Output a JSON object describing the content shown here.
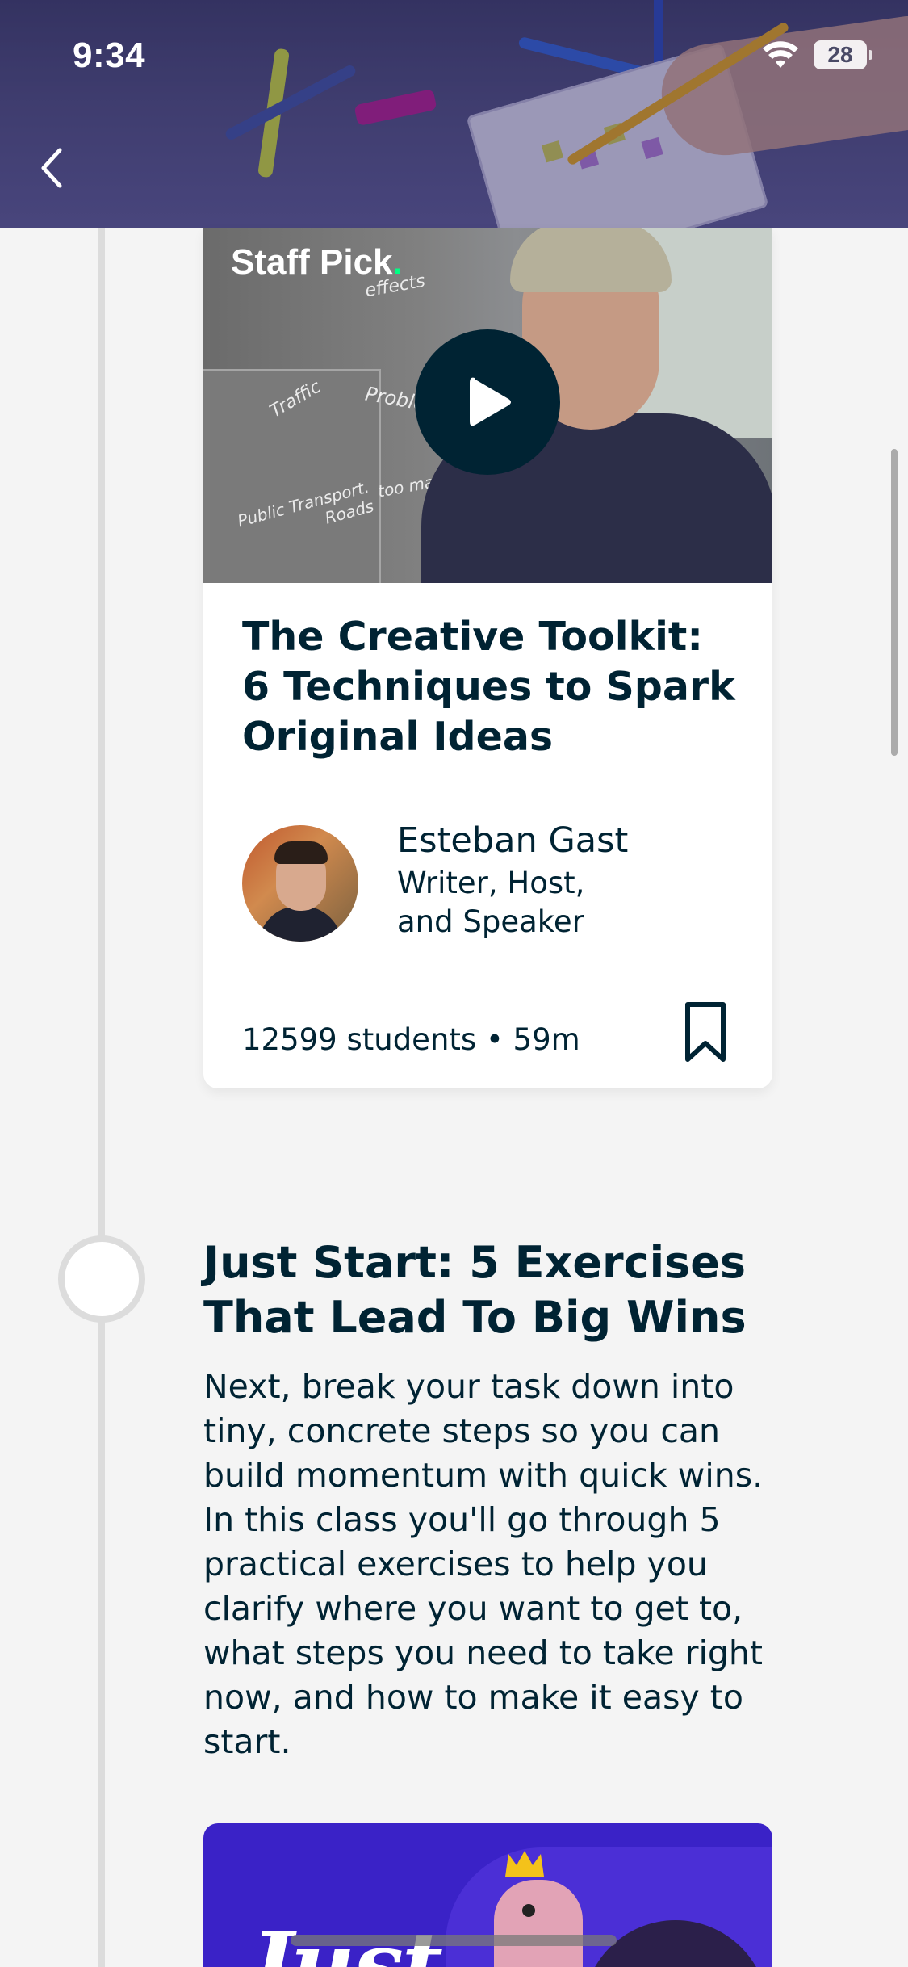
{
  "status_bar": {
    "time": "9:34",
    "battery": "28"
  },
  "header": {
    "back_icon": "chevron-left-icon"
  },
  "video_card": {
    "badge": "Staff Pick",
    "badge_dot_color": "#00ff84",
    "play_icon": "play-icon",
    "title": "The Creative Toolkit:  6 Techniques to Spark Original Ideas",
    "teacher_name": "Esteban Gast",
    "teacher_role": "Writer, Host, and Speaker",
    "meta": "12599 students • 59m",
    "bookmark_icon": "bookmark-icon"
  },
  "next_section": {
    "title": "Just Start: 5 Exercises That Lead To Big Wins",
    "description": "Next, break your task down into tiny, concrete steps so you can build momentum with quick wins. In this class you'll go through 5 practical exercises to help you clarify where you want to get to, what steps you need to take right now, and how to make it easy to start."
  },
  "next_card": {
    "title_partial": "Just"
  },
  "colors": {
    "text": "#002333",
    "background": "#f4f4f4",
    "accent_green": "#00ff84",
    "next_card_bg": "#3a22c7"
  }
}
